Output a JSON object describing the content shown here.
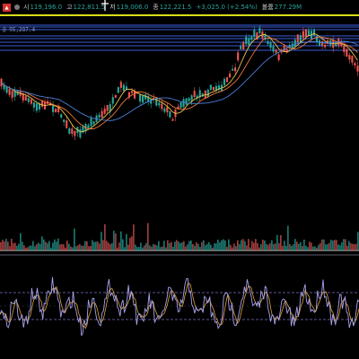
{
  "info_bar": {
    "open_label": "시",
    "open_value": "119,196.0",
    "high_label": "고",
    "high_value": "122,811.5",
    "low_label": "저",
    "low_value": "119,006.0",
    "close_label": "종",
    "close_value": "122,221.5",
    "change_value": "+3,025.0 (+2.54%)",
    "volume_label": "볼륨",
    "volume_value": "277.29M"
  },
  "price_tag": "@ 95,287.4",
  "colors": {
    "up": "#26a69a",
    "down": "#ef5350",
    "ma_fast": "#e8c547",
    "ma_mid": "#f0783c",
    "ma_slow": "#4a7fd6",
    "yellow_line": "#d8dd1a",
    "level_line": "#3a5dd8",
    "osc_line": "#a8a3ef",
    "osc_signal": "#e0a23a",
    "osc_band": "#7d6fbf",
    "separator": "#5b5b6b"
  },
  "icons": [
    "app-logo-icon",
    "status-dot-icon",
    "cursor-icon"
  ]
}
